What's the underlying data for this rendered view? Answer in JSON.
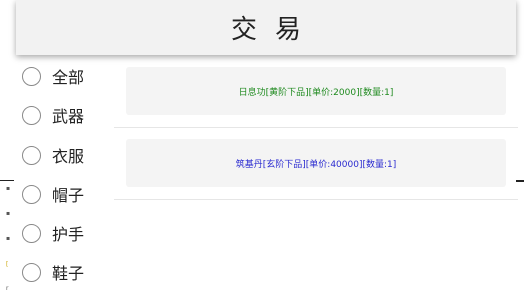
{
  "header": {
    "title": "交易"
  },
  "filters": [
    {
      "label": "全部"
    },
    {
      "label": "武器"
    },
    {
      "label": "衣服"
    },
    {
      "label": "帽子"
    },
    {
      "label": "护手"
    },
    {
      "label": "鞋子"
    }
  ],
  "items": [
    {
      "text": "日息功[黄阶下品][单价:2000][数量:1]",
      "color": "#1f8a1f"
    },
    {
      "text": "筑基丹[玄阶下品][单价:40000][数量:1]",
      "color": "#2a2ad0"
    }
  ],
  "colors": {
    "header_bg": "#f2f2f2",
    "item_bg": "#f4f4f4"
  }
}
